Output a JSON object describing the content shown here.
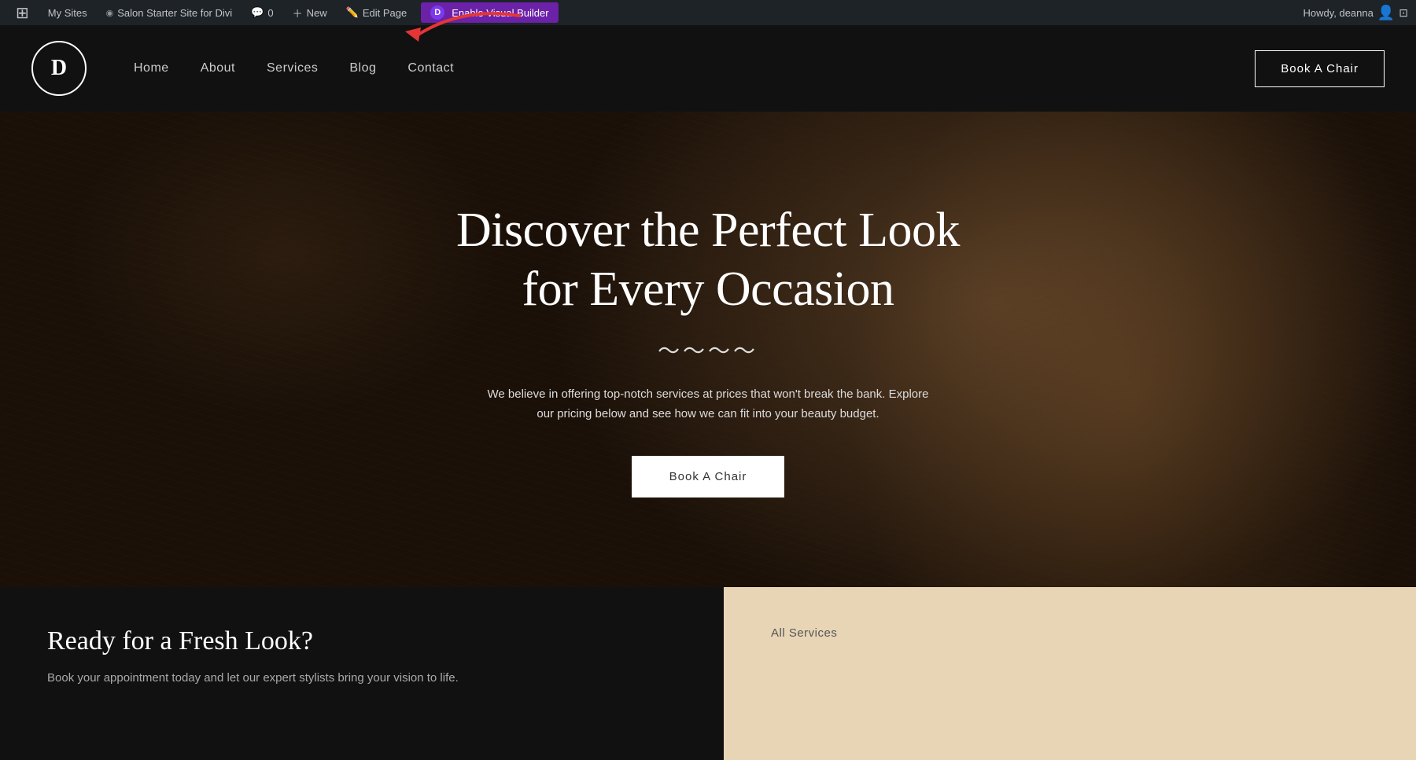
{
  "adminBar": {
    "mySites": "My Sites",
    "siteName": "Salon Starter Site for Divi",
    "comments": "0",
    "new": "New",
    "editPage": "Edit Page",
    "enableVisualBuilder": "Enable Visual Builder",
    "howdy": "Howdy, deanna"
  },
  "nav": {
    "logoLetter": "D",
    "links": [
      {
        "label": "Home",
        "id": "home"
      },
      {
        "label": "About",
        "id": "about"
      },
      {
        "label": "Services",
        "id": "services"
      },
      {
        "label": "Blog",
        "id": "blog"
      },
      {
        "label": "Contact",
        "id": "contact"
      }
    ],
    "bookChairBtn": "Book A Chair"
  },
  "hero": {
    "title": "Discover the Perfect Look for Every Occasion",
    "divider": "〜〜〜〜",
    "subtitle": "We believe in offering top-notch services at prices that won't break the bank. Explore\nour pricing below and see how we can fit into your beauty budget.",
    "ctaBtn": "Book A Chair"
  },
  "bottom": {
    "left": {
      "heading": "Ready for a Fresh Look?",
      "text": "Book your appointment today and let our expert stylists bring your vision to life."
    },
    "right": {
      "allServices": "All Services"
    }
  }
}
